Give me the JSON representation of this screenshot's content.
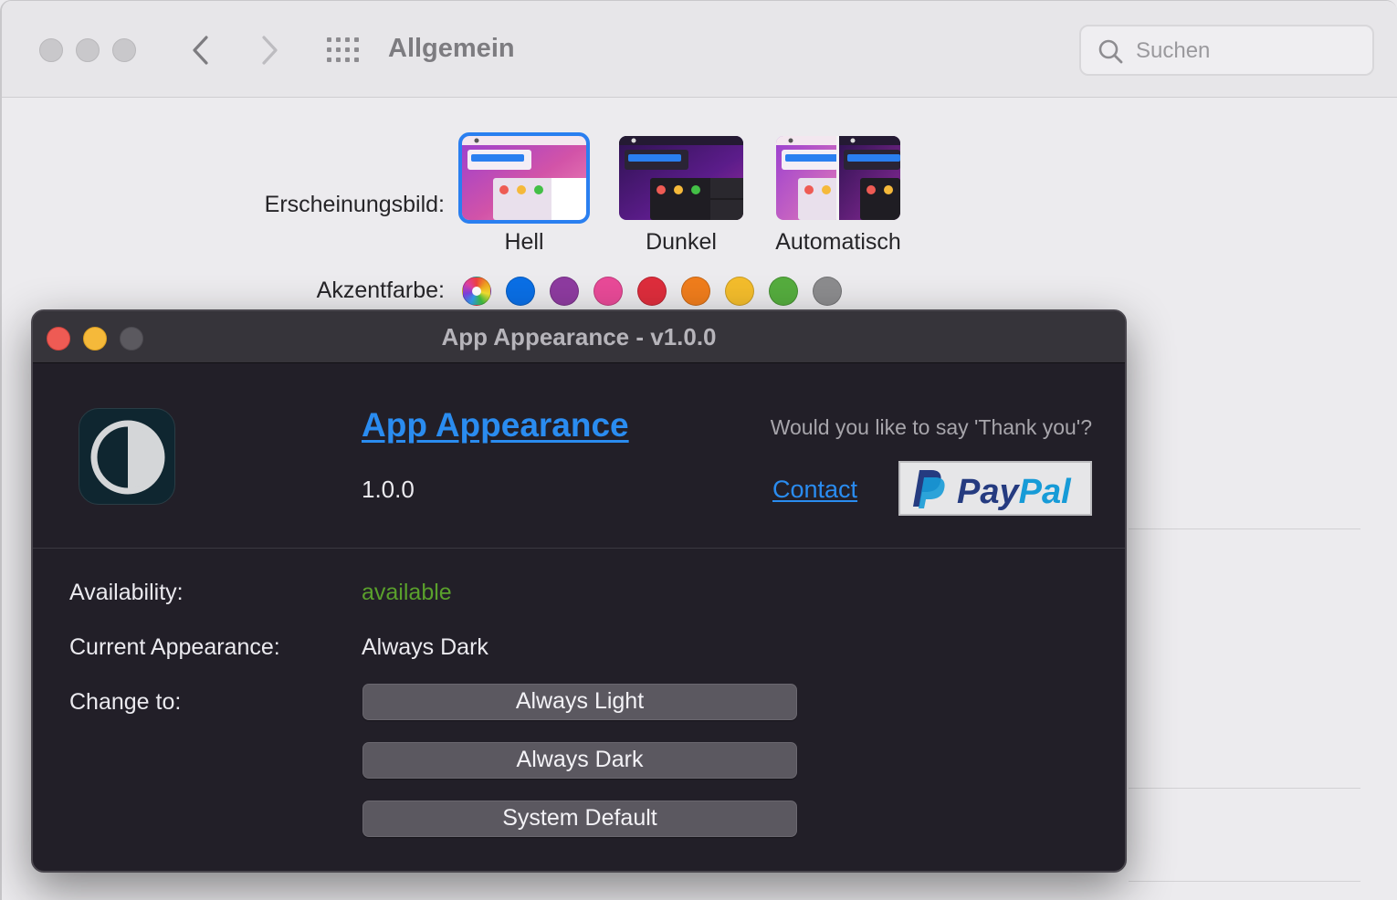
{
  "prefs": {
    "title": "Allgemein",
    "search_placeholder": "Suchen",
    "appearance_label": "Erscheinungsbild:",
    "appearance_options": [
      {
        "label": "Hell",
        "selected": true
      },
      {
        "label": "Dunkel",
        "selected": false
      },
      {
        "label": "Automatisch",
        "selected": false
      }
    ],
    "accent_label": "Akzentfarbe:",
    "accent_colors": [
      "multicolor",
      "#0a6fe6",
      "#8e3ba0",
      "#e94a98",
      "#de2d3c",
      "#f07d1c",
      "#f4bd2c",
      "#55ad3e",
      "#8c8c8e"
    ]
  },
  "app": {
    "window_title": "App Appearance -  v1.0.0",
    "name": "App Appearance",
    "version": "1.0.0",
    "thanks_text": "Would you like to say 'Thank you'?",
    "contact_label": "Contact",
    "paypal_label": "PayPal",
    "availability_label": "Availability:",
    "availability_value": "available",
    "current_label": "Current Appearance:",
    "current_value": "Always Dark",
    "change_label": "Change to:",
    "buttons": [
      "Always Light",
      "Always Dark",
      "System Default"
    ],
    "colors": {
      "link": "#2a8cf0",
      "available": "#5aa02c",
      "background": "#221f28"
    }
  }
}
